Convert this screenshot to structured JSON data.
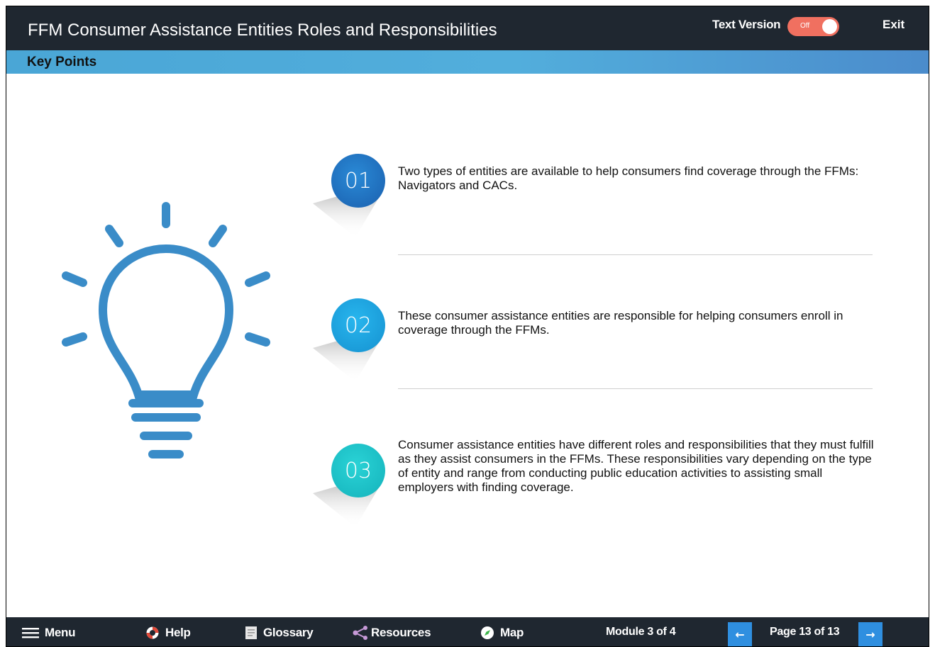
{
  "header": {
    "title": "FFM Consumer Assistance Entities Roles and Responsibilities",
    "text_version_label": "Text Version",
    "toggle_state": "Off",
    "exit_label": "Exit"
  },
  "section": {
    "title": "Key Points"
  },
  "points": [
    {
      "number": "01",
      "color": "#1f73c6",
      "text": "Two types of entities are available to help consumers find coverage through the FFMs: Navigators and CACs."
    },
    {
      "number": "02",
      "color": "#1ca6e0",
      "text": "These consumer assistance entities are responsible for helping consumers enroll in coverage through the FFMs."
    },
    {
      "number": "03",
      "color": "#19c3c7",
      "text": "Consumer assistance entities have different roles and responsibilities that they must fulfill as they assist consumers in the FFMs. These responsibilities vary depending on the type of entity and range from conducting public education activities to assisting small employers with finding coverage."
    }
  ],
  "illustration": {
    "icon": "lightbulb-icon",
    "color": "#3a8cc8"
  },
  "nav": {
    "menu": "Menu",
    "help": "Help",
    "glossary": "Glossary",
    "resources": "Resources",
    "map": "Map",
    "module": "Module 3 of 4",
    "page": "Page 13 of 13",
    "prev_icon": "arrow-left-icon",
    "next_icon": "arrow-right-icon"
  }
}
